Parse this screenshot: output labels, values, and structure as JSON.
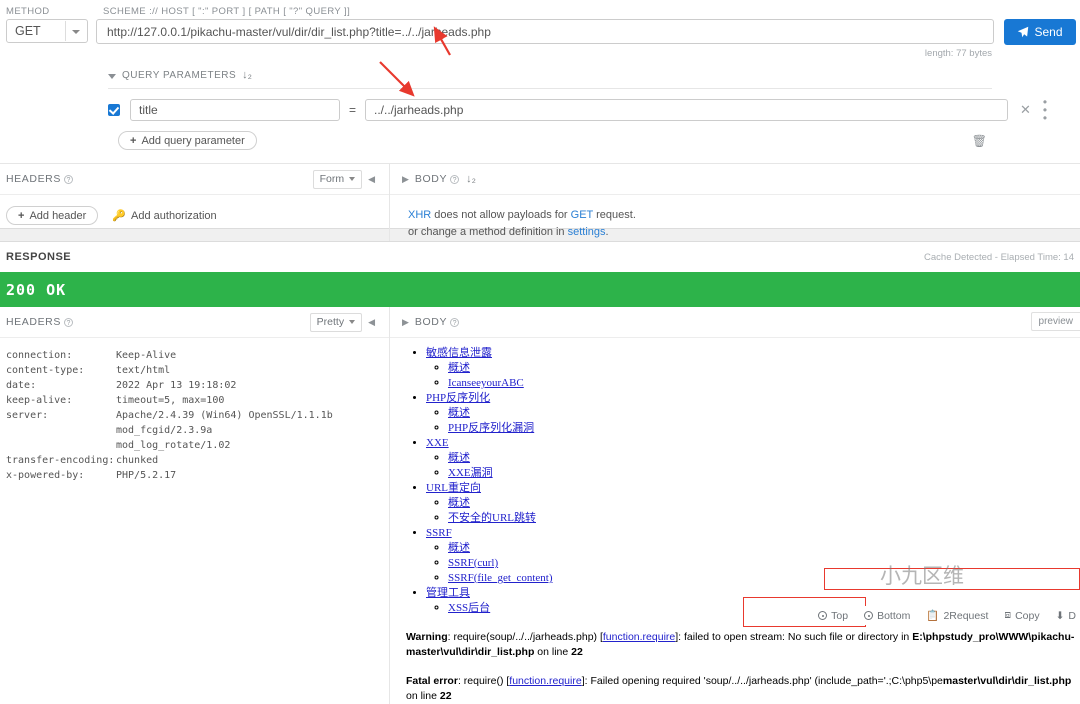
{
  "request": {
    "method_label": "METHOD",
    "method_value": "GET",
    "url_label": "SCHEME :// HOST [ \":\" PORT ] [ PATH [ \"?\" QUERY ]]",
    "url_value": "http://127.0.0.1/pikachu-master/vul/dir/dir_list.php?title=../../jarheads.php",
    "length_text": "length: 77 bytes",
    "send_label": "Send",
    "query_params": {
      "title": "QUERY PARAMETERS",
      "rows": [
        {
          "enabled": true,
          "key": "title",
          "eq": "=",
          "value": "../../jarheads.php"
        }
      ],
      "add_label": "Add query parameter"
    },
    "headers_panel": {
      "title": "HEADERS",
      "format_value": "Form",
      "add_header_label": "Add header",
      "add_auth_label": "Add authorization"
    },
    "body_panel": {
      "title": "BODY",
      "note_line1_a": "XHR",
      "note_line1_b": " does not allow payloads for ",
      "note_line1_c": "GET",
      "note_line1_d": " request.",
      "note_line2_a": "or change a method definition in ",
      "note_line2_b": "settings",
      "note_line2_c": "."
    }
  },
  "response": {
    "title": "RESPONSE",
    "cache_text": "Cache Detected - Elapsed Time: 14",
    "status": "200 OK",
    "headers_panel": {
      "title": "HEADERS",
      "format_value": "Pretty",
      "rows": [
        {
          "key": "connection:",
          "value": "Keep-Alive"
        },
        {
          "key": "content-type:",
          "value": "text/html"
        },
        {
          "key": "date:",
          "value": "2022 Apr 13 19:18:02"
        },
        {
          "key": "keep-alive:",
          "value": "timeout=5, max=100"
        },
        {
          "key": "server:",
          "value": "Apache/2.4.39 (Win64) OpenSSL/1.1.1b mod_fcgid/2.3.9a\nmod_log_rotate/1.02"
        },
        {
          "key": "transfer-encoding:",
          "value": "chunked"
        },
        {
          "key": "x-powered-by:",
          "value": "PHP/5.2.17"
        }
      ]
    },
    "body_panel": {
      "title": "BODY",
      "preview_label": "preview",
      "list": [
        {
          "label": "敏感信息泄露",
          "children": [
            "概述",
            "IcanseeyourABC"
          ]
        },
        {
          "label": "PHP反序列化",
          "children": [
            "概述",
            "PHP反序列化漏洞"
          ]
        },
        {
          "label": "XXE",
          "children": [
            "概述",
            "XXE漏洞"
          ]
        },
        {
          "label": "URL重定向",
          "children": [
            "概述",
            "不安全的URL跳转"
          ]
        },
        {
          "label": "SSRF",
          "children": [
            "概述",
            "SSRF(curl)",
            "SSRF(file_get_content)"
          ]
        },
        {
          "label": "管理工具",
          "children": [
            "XSS后台"
          ]
        }
      ],
      "warning": {
        "label": "Warning",
        "text1": ": require(soup/../../jarheads.php) [",
        "link": "function.require",
        "text2": "]: failed to open stream: No such file or directory in ",
        "path_bold": "E:\\phpstudy_pro\\WWW\\pikachu-master\\vul\\dir\\dir_list.php",
        "line": " on line ",
        "line_no": "22"
      },
      "fatal": {
        "label": "Fatal error",
        "text1": ": require() [",
        "link": "function.require",
        "text2": "]: Failed opening required 'soup/../../jarheads.php' (include_path='.;C:\\php5\\pe",
        "path_bold": "master\\vul\\dir\\dir_list.php",
        "line": " on line ",
        "line_no": "22"
      }
    }
  },
  "floating_toolbar": {
    "items": [
      "Top",
      "Bottom",
      "2Request",
      "Copy",
      "D"
    ]
  },
  "watermark": "小九区维",
  "colors": {
    "accent_blue": "#1878d4",
    "status_green": "#2db34a",
    "link_blue": "#2222cc",
    "annotation_red": "#e8392e"
  }
}
